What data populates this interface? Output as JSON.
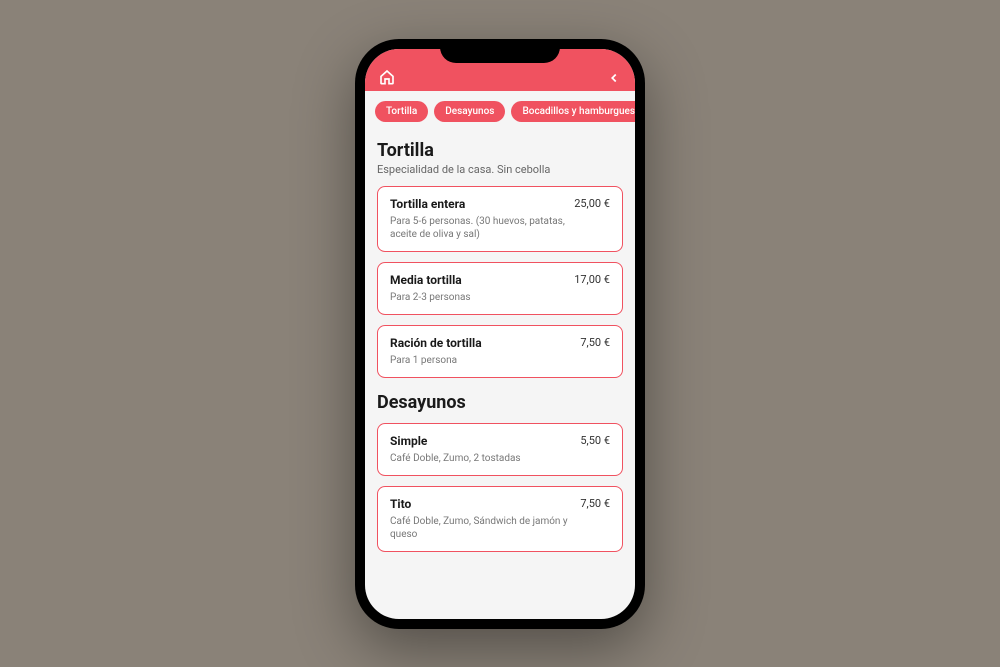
{
  "colors": {
    "accent": "#f05260"
  },
  "tabs": [
    {
      "label": "Tortilla"
    },
    {
      "label": "Desayunos"
    },
    {
      "label": "Bocadillos y hamburguesas"
    }
  ],
  "sections": [
    {
      "title": "Tortilla",
      "subtitle": "Especialidad de la casa. Sin cebolla",
      "items": [
        {
          "name": "Tortilla entera",
          "price": "25,00 €",
          "desc": "Para 5-6 personas. (30 huevos, patatas, aceite de oliva y sal)"
        },
        {
          "name": "Media tortilla",
          "price": "17,00 €",
          "desc": "Para 2-3 personas"
        },
        {
          "name": "Ración de tortilla",
          "price": "7,50 €",
          "desc": "Para 1 persona"
        }
      ]
    },
    {
      "title": "Desayunos",
      "subtitle": "",
      "items": [
        {
          "name": "Simple",
          "price": "5,50 €",
          "desc": "Café Doble, Zumo, 2 tostadas"
        },
        {
          "name": "Tito",
          "price": "7,50 €",
          "desc": "Café Doble, Zumo, Sándwich de jamón y queso"
        }
      ]
    }
  ]
}
